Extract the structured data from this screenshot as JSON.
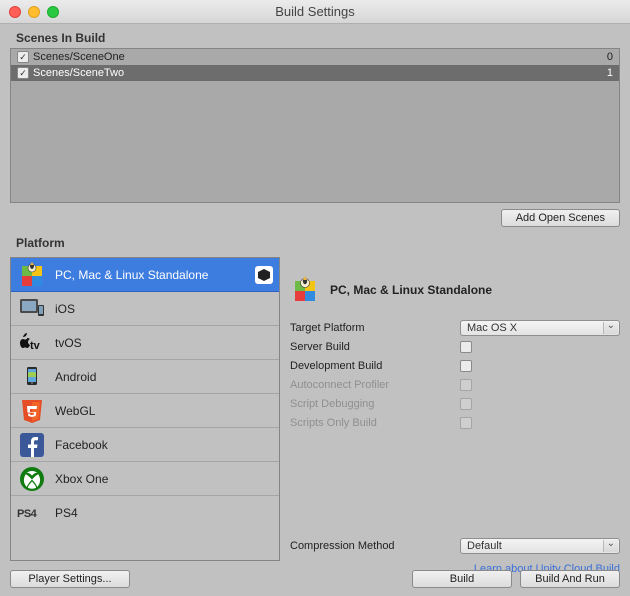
{
  "window": {
    "title": "Build Settings"
  },
  "scenes": {
    "label": "Scenes In Build",
    "items": [
      {
        "path": "Scenes/SceneOne",
        "index": "0",
        "checked": true,
        "selected": false
      },
      {
        "path": "Scenes/SceneTwo",
        "index": "1",
        "checked": true,
        "selected": true
      }
    ],
    "add_button": "Add Open Scenes"
  },
  "platform": {
    "label": "Platform",
    "items": [
      {
        "label": "PC, Mac & Linux Standalone",
        "selected": true,
        "current": true
      },
      {
        "label": "iOS"
      },
      {
        "label": "tvOS"
      },
      {
        "label": "Android"
      },
      {
        "label": "WebGL"
      },
      {
        "label": "Facebook"
      },
      {
        "label": "Xbox One"
      },
      {
        "label": "PS4"
      }
    ]
  },
  "settings": {
    "title": "PC, Mac & Linux Standalone",
    "target_platform_label": "Target Platform",
    "target_platform_value": "Mac OS X",
    "server_build_label": "Server Build",
    "dev_build_label": "Development Build",
    "autoconnect_label": "Autoconnect Profiler",
    "script_debug_label": "Script Debugging",
    "scripts_only_label": "Scripts Only Build",
    "compression_label": "Compression Method",
    "compression_value": "Default",
    "learn_link": "Learn about Unity Cloud Build"
  },
  "footer": {
    "player_settings": "Player Settings...",
    "build": "Build",
    "build_and_run": "Build And Run"
  }
}
